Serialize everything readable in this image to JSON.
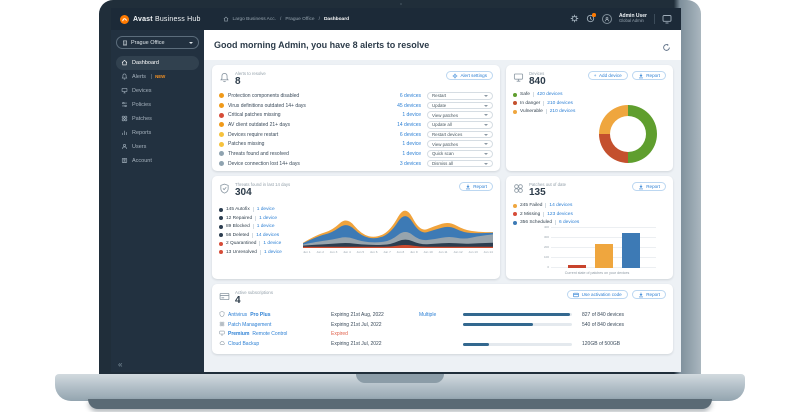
{
  "topbar": {
    "brand_bold": "Avast",
    "brand_rest": " Business Hub",
    "breadcrumb": [
      "Largo Business Acc.",
      "Prague Office",
      "Dashboard"
    ],
    "breadcrumb_separator": "/",
    "user_name": "Admin User",
    "user_role": "Global Admin"
  },
  "sidebar": {
    "site_selector": "Prague Office",
    "collapse_glyph": "«",
    "items": [
      {
        "label": "Dashboard",
        "active": true
      },
      {
        "label": "Alerts",
        "badge": "NEW"
      },
      {
        "label": "Devices"
      },
      {
        "label": "Policies"
      },
      {
        "label": "Patches"
      },
      {
        "label": "Reports"
      },
      {
        "label": "Users"
      },
      {
        "label": "Account"
      }
    ]
  },
  "greeting": "Good morning Admin, you have 8 alerts to resolve",
  "alerts_card": {
    "title": "Alerts to resolve",
    "count": "8",
    "settings_button": "Alert settings",
    "rows": [
      {
        "severity_color": "#f09a1a",
        "label": "Protection components disabled",
        "devices": "6 devices",
        "action": "Restart"
      },
      {
        "severity_color": "#f09a1a",
        "label": "Virus definitions outdated 14+ days",
        "devices": "45 devices",
        "action": "Update"
      },
      {
        "severity_color": "#d64c38",
        "label": "Critical patches missing",
        "devices": "1 device",
        "action": "View patches"
      },
      {
        "severity_color": "#f09a1a",
        "label": "AV client outdated 21+ days",
        "devices": "14 devices",
        "action": "Update all"
      },
      {
        "severity_color": "#f6c23d",
        "label": "Devices require restart",
        "devices": "6 devices",
        "action": "Restart devices"
      },
      {
        "severity_color": "#f6c23d",
        "label": "Patches missing",
        "devices": "1 device",
        "action": "View patches"
      },
      {
        "severity_color": "#8fa3b0",
        "label": "Threats found and resolved",
        "devices": "1 device",
        "action": "Quick scan"
      },
      {
        "severity_color": "#8fa3b0",
        "label": "Device connection lost 14+ days",
        "devices": "3 devices",
        "action": "Dismiss all"
      }
    ]
  },
  "devices_card": {
    "title": "Devices",
    "count": "840",
    "add_button": "Add device",
    "report_button": "Report",
    "legend": [
      {
        "label": "Safe",
        "devices": "420 devices",
        "color": "#5f9e2e"
      },
      {
        "label": "In danger",
        "devices": "210 devices",
        "color": "#c4502e"
      },
      {
        "label": "Vulnerable",
        "devices": "210 devices",
        "color": "#efa63e"
      }
    ],
    "chart_data": {
      "type": "pie",
      "donut": true,
      "segments": [
        {
          "name": "Safe",
          "value": 420,
          "color": "#5f9e2e"
        },
        {
          "name": "In danger",
          "value": 210,
          "color": "#c4502e"
        },
        {
          "name": "Vulnerable",
          "value": 210,
          "color": "#efa63e"
        }
      ]
    }
  },
  "threats_card": {
    "title": "Threats found in last 14 days",
    "count": "304",
    "report_button": "Report",
    "legend": [
      {
        "count": "145",
        "name": "Autofix",
        "devices": "1 device",
        "color": "#2c3e50"
      },
      {
        "count": "12",
        "name": "Repaired",
        "devices": "1 device",
        "color": "#2c3e50"
      },
      {
        "count": "89",
        "name": "Blocked",
        "devices": "1 device",
        "color": "#2c3e50"
      },
      {
        "count": "56",
        "name": "Deleted",
        "devices": "14 devices",
        "color": "#2c3e50"
      },
      {
        "count": "2",
        "name": "Quarantined",
        "devices": "1 device",
        "color": "#d64c38"
      },
      {
        "count": "13",
        "name": "Unresolved",
        "devices": "1 device",
        "color": "#d64c38"
      }
    ],
    "chart_data": {
      "type": "area",
      "stacked": true,
      "x": [
        "Jun 1",
        "Jun 2",
        "Jun 3",
        "Jun 4",
        "Jun 5",
        "Jun 6",
        "Jun 7",
        "Jun 8",
        "Jun 9",
        "Jun 10",
        "Jun 11",
        "Jun 12",
        "Jun 13",
        "Jun 14"
      ],
      "series": [
        {
          "name": "Unresolved",
          "color": "#cf4b2e",
          "values": [
            2,
            2,
            2,
            2,
            2,
            2,
            2,
            6,
            2,
            2,
            2,
            2,
            2,
            2
          ]
        },
        {
          "name": "Deleted",
          "color": "#2b3d4f",
          "values": [
            2,
            4,
            5,
            7,
            4,
            3,
            4,
            11,
            4,
            5,
            7,
            5,
            6,
            7
          ]
        },
        {
          "name": "Blocked",
          "color": "#97a4ad",
          "values": [
            2,
            5,
            7,
            11,
            5,
            4,
            6,
            15,
            6,
            8,
            11,
            8,
            12,
            14
          ]
        },
        {
          "name": "Autofix",
          "color": "#3d7ab5",
          "values": [
            2,
            9,
            12,
            24,
            9,
            6,
            13,
            32,
            11,
            16,
            18,
            11,
            5,
            3
          ]
        },
        {
          "name": "Repaired",
          "color": "#f0a33c",
          "values": [
            1,
            3,
            4,
            9,
            3,
            2,
            5,
            11,
            4,
            6,
            7,
            5,
            2,
            1
          ]
        }
      ]
    }
  },
  "patches_card": {
    "title": "Patches out of date",
    "count": "135",
    "report_button": "Report",
    "legend": [
      {
        "count": "245",
        "name": "Failed",
        "devices": "14 devices",
        "color": "#efa63e"
      },
      {
        "count": "2",
        "name": "Missing",
        "devices": "123 devices",
        "color": "#d64c38"
      },
      {
        "count": "356",
        "name": "Scheduled",
        "devices": "6 devices",
        "color": "#3d7ab5"
      }
    ],
    "chart_data": {
      "type": "bar",
      "categories": [
        "Missing",
        "Failed",
        "Scheduled"
      ],
      "values": [
        2,
        245,
        356
      ],
      "colors": [
        "#c8432c",
        "#efa63e",
        "#3d7ab5"
      ],
      "ylim": [
        0,
        400
      ],
      "yticks": [
        0,
        100,
        200,
        300,
        400
      ],
      "caption": "Current state of patches on your devices"
    }
  },
  "subscriptions_card": {
    "title": "Active subscriptions",
    "count": "4",
    "activation_button": "Use activation code",
    "report_button": "Report",
    "progress_color": "#33688f",
    "rows": [
      {
        "icon": "shield-icon",
        "name_parts": [
          {
            "text": "Antivirus ",
            "bold": false
          },
          {
            "text": "Pro Plus",
            "bold": true
          }
        ],
        "expiry": "Expiring 21st Aug, 2022",
        "expired": false,
        "extra_link": "Multiple",
        "progress": 827,
        "progress_max": 840,
        "usage": "827 of 840 devices"
      },
      {
        "icon": "patches-icon",
        "name_parts": [
          {
            "text": "Patch Management",
            "bold": false
          }
        ],
        "expiry": "Expiring 21st Jul, 2022",
        "expired": false,
        "extra_link": "",
        "progress": 540,
        "progress_max": 840,
        "usage": "540 of 840 devices"
      },
      {
        "icon": "remote-icon",
        "name_parts": [
          {
            "text": "Premium ",
            "bold": true
          },
          {
            "text": "Remote Control",
            "bold": false
          }
        ],
        "expiry": "Expired",
        "expired": true,
        "extra_link": "",
        "progress": null,
        "progress_max": null,
        "usage": ""
      },
      {
        "icon": "cloud-icon",
        "name_parts": [
          {
            "text": "Cloud Backup",
            "bold": false
          }
        ],
        "expiry": "Expiring 21st Jul, 2022",
        "expired": false,
        "extra_link": "",
        "progress": 120,
        "progress_max": 500,
        "usage": "120GB of 500GB"
      }
    ]
  }
}
